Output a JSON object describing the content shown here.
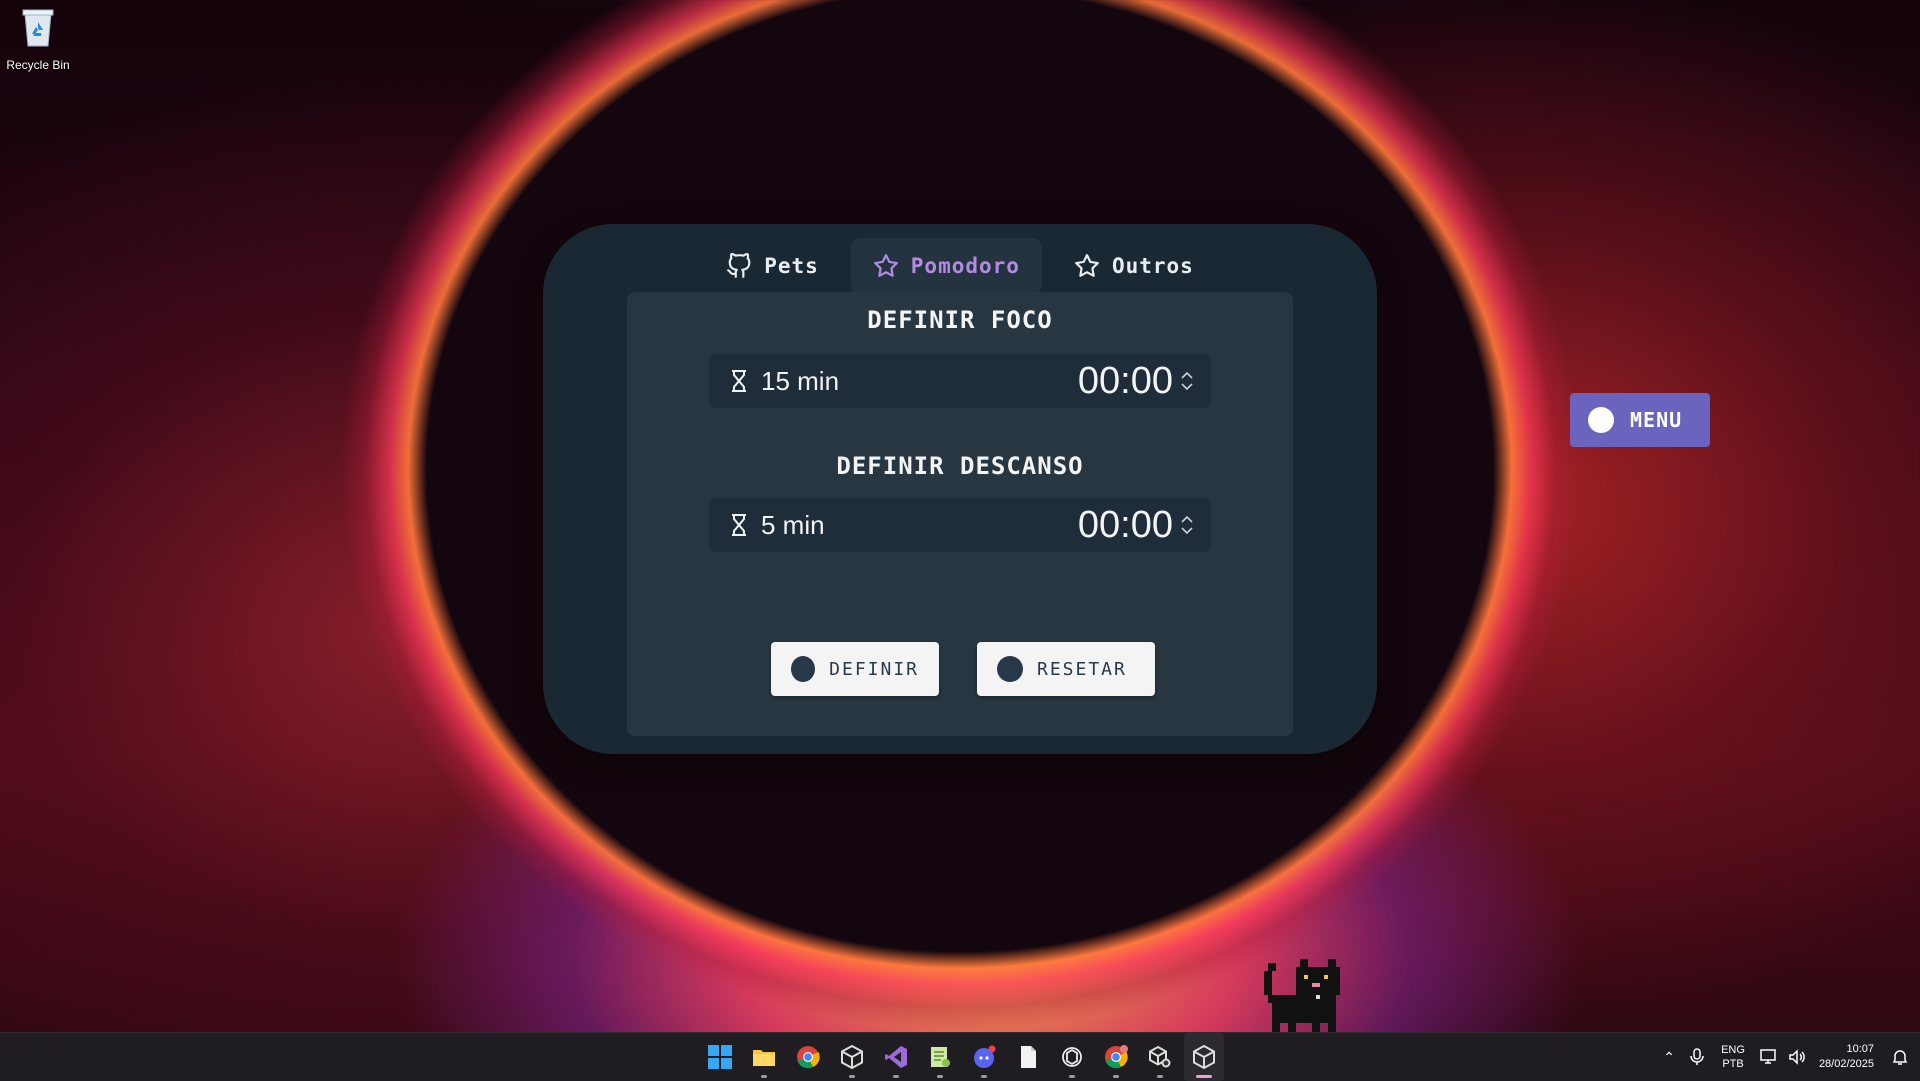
{
  "desktop": {
    "recycle_bin_label": "Recycle Bin"
  },
  "tabs": [
    {
      "label": "Pets",
      "icon": "github-icon"
    },
    {
      "label": "Pomodoro",
      "icon": "star-icon",
      "active": true
    },
    {
      "label": "Outros",
      "icon": "star-icon"
    }
  ],
  "focus": {
    "title": "DEFINIR FOCO",
    "duration": "15 min",
    "time": "00:00"
  },
  "rest": {
    "title": "DEFINIR DESCANSO",
    "duration": "5 min",
    "time": "00:00"
  },
  "buttons": {
    "define": "DEFINIR",
    "reset": "RESETAR"
  },
  "menu": {
    "label": "MENU"
  },
  "taskbar": {
    "apps": [
      "windows-start",
      "file-explorer",
      "chrome",
      "unity-hub",
      "visual-studio",
      "notepad-plus",
      "discord",
      "file",
      "chatgpt",
      "chrome-profile",
      "unity-settings",
      "unity"
    ],
    "language": {
      "line1": "ENG",
      "line2": "PTB"
    },
    "clock": {
      "time": "10:07",
      "date": "28/02/2025"
    }
  },
  "colors": {
    "panel": "#1a2833",
    "inner": "#283641",
    "accent": "#b38be0",
    "menu": "#6a64be"
  }
}
